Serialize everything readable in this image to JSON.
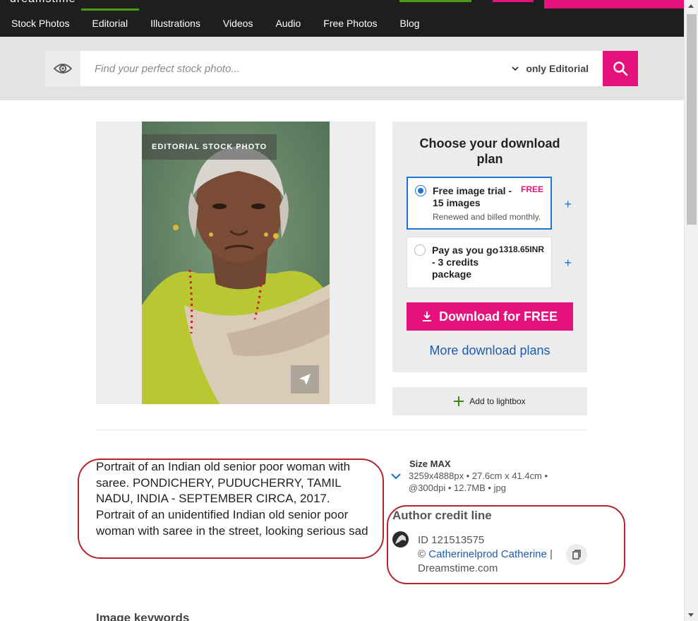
{
  "brand": {
    "logo_fragment": "dreamstime"
  },
  "nav": {
    "items": [
      {
        "label": "Stock Photos"
      },
      {
        "label": "Editorial"
      },
      {
        "label": "Illustrations"
      },
      {
        "label": "Videos"
      },
      {
        "label": "Audio"
      },
      {
        "label": "Free Photos"
      },
      {
        "label": "Blog"
      }
    ],
    "active": "Editorial"
  },
  "search": {
    "placeholder": "Find your perfect stock photo...",
    "filter_label": "only Editorial",
    "visibility_icon": "eye-icon",
    "submit_icon": "search-icon"
  },
  "photo": {
    "badge": "EDITORIAL STOCK PHOTO",
    "share_icon": "paper-plane-icon"
  },
  "plans": {
    "title": "Choose your download plan",
    "options": [
      {
        "name": "Free image trial - 15 images",
        "sub": "Renewed and billed monthly.",
        "price": "FREE",
        "selected": true
      },
      {
        "name": "Pay as you go - 3 credits package",
        "sub": "",
        "price": "1318.65INR",
        "selected": false
      }
    ],
    "expand_icon": "plus-icon",
    "download_label": "Download for FREE",
    "download_icon": "download-icon",
    "more_label": "More download plans"
  },
  "lightbox": {
    "label": "Add to lightbox",
    "icon": "plus-icon"
  },
  "description": "Portrait of an Indian old senior poor woman with saree. PONDICHERY, PUDUCHERRY, TAMIL NADU, INDIA - SEPTEMBER CIRCA, 2017. Portrait of an unidentified Indian old senior poor woman with saree in the street, looking serious sad",
  "size": {
    "title": "Size MAX",
    "info": "3259x4888px • 27.6cm x 41.4cm • @300dpi • 12.7MB • jpg"
  },
  "author": {
    "title": "Author credit line",
    "id": "ID 121513575",
    "copyright_prefix": "© ",
    "name": "Catherinelprod Catherine",
    "suffix": " | Dreamstime.com",
    "copy_icon": "copy-icon"
  },
  "keywords_title": "Image keywords",
  "colors": {
    "accent_pink": "#e5127d",
    "accent_green": "#4a9a16",
    "link_blue": "#1d5cb0",
    "highlight_red": "#b6242f"
  }
}
